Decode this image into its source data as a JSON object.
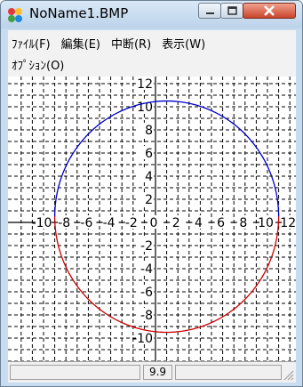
{
  "window": {
    "title": "NoName1.BMP"
  },
  "menu": {
    "items": [
      {
        "label": "ﾌｧｲﾙ(F)"
      },
      {
        "label": "編集(E)"
      },
      {
        "label": "中断(R)"
      },
      {
        "label": "表示(W)"
      },
      {
        "label": "ｵﾌﾟｼｮﾝ(O)"
      }
    ]
  },
  "plot": {
    "x_ticks": [
      "-10",
      "-8",
      "-6",
      "-4",
      "-2",
      "0",
      "2",
      "4",
      "6",
      "8",
      "10",
      "12"
    ],
    "y_ticks": [
      "12",
      "10",
      "8",
      "6",
      "4",
      "2",
      "-2",
      "-4",
      "-6",
      "-8",
      "-10"
    ],
    "circle": {
      "center_x": 1,
      "center_y": 0.5,
      "radius": 10
    },
    "upper_color": "#0000cc",
    "lower_color": "#cc0000"
  },
  "status": {
    "value": "9.9"
  }
}
